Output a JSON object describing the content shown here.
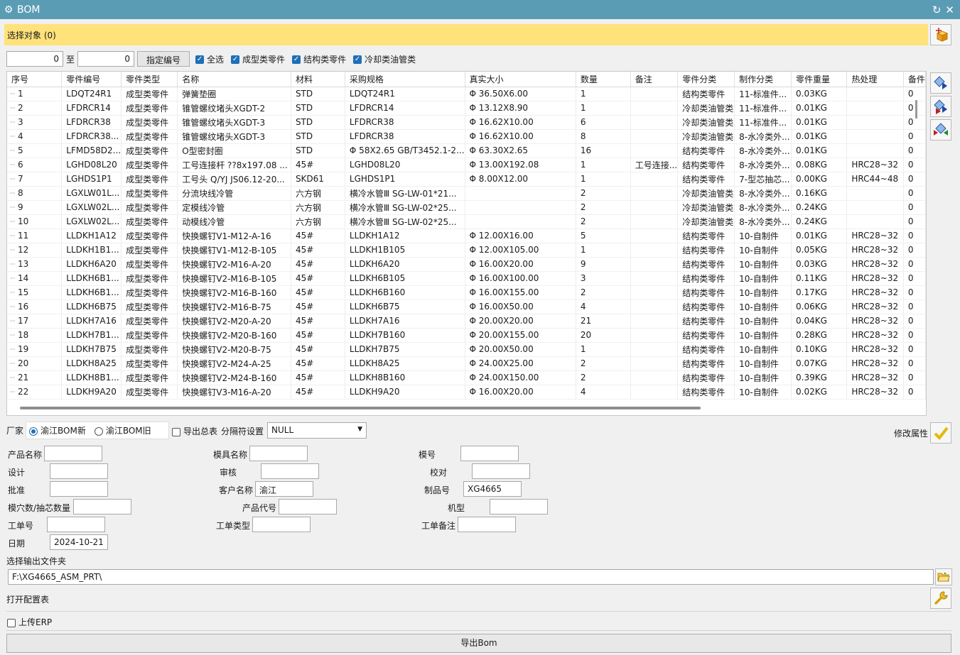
{
  "window": {
    "title": "BOM"
  },
  "select_bar": {
    "label": "选择对象 (0)"
  },
  "range": {
    "from": "0",
    "to_label": "至",
    "to": "0",
    "assign_button": "指定编号"
  },
  "filters": [
    {
      "label": "全选",
      "checked": true
    },
    {
      "label": "成型类零件",
      "checked": true
    },
    {
      "label": "结构类零件",
      "checked": true
    },
    {
      "label": "冷却类油管类",
      "checked": true
    }
  ],
  "table": {
    "columns": [
      "序号",
      "零件编号",
      "零件类型",
      "名称",
      "材料",
      "采购规格",
      "真实大小",
      "数量",
      "备注",
      "零件分类",
      "制作分类",
      "零件重量",
      "热处理",
      "备件"
    ],
    "rows": [
      [
        "1",
        "LDQT24R1",
        "成型类零件",
        "弹簧垫圈",
        "STD",
        "LDQT24R1",
        "Φ 36.50X6.00",
        "1",
        "",
        "结构类零件",
        "11-标准件...",
        "0.03KG",
        "",
        "0"
      ],
      [
        "2",
        "LFDRCR14",
        "成型类零件",
        "锥管螺纹堵头XGDT-2",
        "STD",
        "LFDRCR14",
        "Φ 13.12X8.90",
        "1",
        "",
        "冷却类油管类",
        "11-标准件...",
        "0.01KG",
        "",
        "0"
      ],
      [
        "3",
        "LFDRCR38",
        "成型类零件",
        "锥管螺纹堵头XGDT-3",
        "STD",
        "LFDRCR38",
        "Φ 16.62X10.00",
        "6",
        "",
        "冷却类油管类",
        "11-标准件...",
        "0.01KG",
        "",
        "0"
      ],
      [
        "4",
        "LFDRCR38...",
        "成型类零件",
        "锥管螺纹堵头XGDT-3",
        "STD",
        "LFDRCR38",
        "Φ 16.62X10.00",
        "8",
        "",
        "冷却类油管类",
        "8-水冷类外...",
        "0.01KG",
        "",
        "0"
      ],
      [
        "5",
        "LFMD58D2...",
        "成型类零件",
        "O型密封圈",
        "STD",
        "Φ 58X2.65 GB/T3452.1-2...",
        "Φ 63.30X2.65",
        "16",
        "",
        "结构类零件",
        "8-水冷类外...",
        "0.01KG",
        "",
        "0"
      ],
      [
        "6",
        "LGHD08L20",
        "成型类零件",
        "工号连接杆 ??8x197.08 ...",
        "45#",
        "LGHD08L20",
        "Φ 13.00X192.08",
        "1",
        "工号连接...",
        "结构类零件",
        "8-水冷类外...",
        "0.08KG",
        "HRC28~32",
        "0"
      ],
      [
        "7",
        "LGHDS1P1",
        "成型类零件",
        "工号头 Q/YJ JS06.12-20...",
        "SKD61",
        "LGHDS1P1",
        "Φ 8.00X12.00",
        "1",
        "",
        "结构类零件",
        "7-型芯抽芯...",
        "0.00KG",
        "HRC44~48",
        "0"
      ],
      [
        "8",
        "LGXLW01L...",
        "成型类零件",
        "分流块线冷管",
        "六方钢",
        "横冷水管Ⅲ SG-LW-01*21...",
        "",
        "2",
        "",
        "冷却类油管类",
        "8-水冷类外...",
        "0.16KG",
        "",
        "0"
      ],
      [
        "9",
        "LGXLW02L...",
        "成型类零件",
        "定模线冷管",
        "六方钢",
        "横冷水管Ⅲ SG-LW-02*25...",
        "",
        "2",
        "",
        "冷却类油管类",
        "8-水冷类外...",
        "0.24KG",
        "",
        "0"
      ],
      [
        "10",
        "LGXLW02L...",
        "成型类零件",
        "动模线冷管",
        "六方钢",
        "横冷水管Ⅲ SG-LW-02*25...",
        "",
        "2",
        "",
        "冷却类油管类",
        "8-水冷类外...",
        "0.24KG",
        "",
        "0"
      ],
      [
        "11",
        "LLDKH1A12",
        "成型类零件",
        "快换螺钉V1-M12-A-16",
        "45#",
        "LLDKH1A12",
        "Φ 12.00X16.00",
        "5",
        "",
        "结构类零件",
        "10-自制件",
        "0.01KG",
        "HRC28~32",
        "0"
      ],
      [
        "12",
        "LLDKH1B1...",
        "成型类零件",
        "快换螺钉V1-M12-B-105",
        "45#",
        "LLDKH1B105",
        "Φ 12.00X105.00",
        "1",
        "",
        "结构类零件",
        "10-自制件",
        "0.05KG",
        "HRC28~32",
        "0"
      ],
      [
        "13",
        "LLDKH6A20",
        "成型类零件",
        "快换螺钉V2-M16-A-20",
        "45#",
        "LLDKH6A20",
        "Φ 16.00X20.00",
        "9",
        "",
        "结构类零件",
        "10-自制件",
        "0.03KG",
        "HRC28~32",
        "0"
      ],
      [
        "14",
        "LLDKH6B1...",
        "成型类零件",
        "快换螺钉V2-M16-B-105",
        "45#",
        "LLDKH6B105",
        "Φ 16.00X100.00",
        "3",
        "",
        "结构类零件",
        "10-自制件",
        "0.11KG",
        "HRC28~32",
        "0"
      ],
      [
        "15",
        "LLDKH6B1...",
        "成型类零件",
        "快换螺钉V2-M16-B-160",
        "45#",
        "LLDKH6B160",
        "Φ 16.00X155.00",
        "2",
        "",
        "结构类零件",
        "10-自制件",
        "0.17KG",
        "HRC28~32",
        "0"
      ],
      [
        "16",
        "LLDKH6B75",
        "成型类零件",
        "快换螺钉V2-M16-B-75",
        "45#",
        "LLDKH6B75",
        "Φ 16.00X50.00",
        "4",
        "",
        "结构类零件",
        "10-自制件",
        "0.06KG",
        "HRC28~32",
        "0"
      ],
      [
        "17",
        "LLDKH7A16",
        "成型类零件",
        "快换螺钉V2-M20-A-20",
        "45#",
        "LLDKH7A16",
        "Φ 20.00X20.00",
        "21",
        "",
        "结构类零件",
        "10-自制件",
        "0.04KG",
        "HRC28~32",
        "0"
      ],
      [
        "18",
        "LLDKH7B1...",
        "成型类零件",
        "快换螺钉V2-M20-B-160",
        "45#",
        "LLDKH7B160",
        "Φ 20.00X155.00",
        "20",
        "",
        "结构类零件",
        "10-自制件",
        "0.28KG",
        "HRC28~32",
        "0"
      ],
      [
        "19",
        "LLDKH7B75",
        "成型类零件",
        "快换螺钉V2-M20-B-75",
        "45#",
        "LLDKH7B75",
        "Φ 20.00X50.00",
        "1",
        "",
        "结构类零件",
        "10-自制件",
        "0.10KG",
        "HRC28~32",
        "0"
      ],
      [
        "20",
        "LLDKH8A25",
        "成型类零件",
        "快换螺钉V2-M24-A-25",
        "45#",
        "LLDKH8A25",
        "Φ 24.00X25.00",
        "2",
        "",
        "结构类零件",
        "10-自制件",
        "0.07KG",
        "HRC28~32",
        "0"
      ],
      [
        "21",
        "LLDKH8B1...",
        "成型类零件",
        "快换螺钉V2-M24-B-160",
        "45#",
        "LLDKH8B160",
        "Φ 24.00X150.00",
        "2",
        "",
        "结构类零件",
        "10-自制件",
        "0.39KG",
        "HRC28~32",
        "0"
      ],
      [
        "22",
        "LLDKH9A20",
        "成型类零件",
        "快换螺钉V3-M16-A-20",
        "45#",
        "LLDKH9A20",
        "Φ 16.00X20.00",
        "4",
        "",
        "结构类零件",
        "10-自制件",
        "0.02KG",
        "HRC28~32",
        "0"
      ]
    ]
  },
  "vendor": {
    "label": "厂家",
    "options": [
      {
        "label": "渝江BOM新",
        "selected": true
      },
      {
        "label": "渝江BOM旧",
        "selected": false
      }
    ]
  },
  "export_total": {
    "label": "导出总表",
    "checked": false
  },
  "separator": {
    "label": "分隔符设置",
    "value": "NULL"
  },
  "modify_label": "修改属性",
  "form": {
    "product_name": {
      "label": "产品名称",
      "value": ""
    },
    "mold_name": {
      "label": "模具名称",
      "value": ""
    },
    "mold_no": {
      "label": "模号",
      "value": ""
    },
    "design": {
      "label": "设计",
      "value": ""
    },
    "review": {
      "label": "审核",
      "value": ""
    },
    "proofread": {
      "label": "校对",
      "value": ""
    },
    "approve": {
      "label": "批准",
      "value": ""
    },
    "customer": {
      "label": "客户名称",
      "value": "渝江"
    },
    "product_no": {
      "label": "制品号",
      "value": "XG4665"
    },
    "cavity": {
      "label": "模穴数/抽芯数量",
      "value": ""
    },
    "product_code": {
      "label": "产品代号",
      "value": ""
    },
    "machine": {
      "label": "机型",
      "value": ""
    },
    "work_order": {
      "label": "工单号",
      "value": ""
    },
    "work_type": {
      "label": "工单类型",
      "value": ""
    },
    "work_note": {
      "label": "工单备注",
      "value": ""
    },
    "date": {
      "label": "日期",
      "value": "2024-10-21"
    }
  },
  "output": {
    "label": "选择输出文件夹",
    "path": "F:\\XG4665_ASM_PRT\\"
  },
  "open_config": "打开配置表",
  "upload_erp": {
    "label": "上传ERP",
    "checked": false
  },
  "export_button": "导出Bom",
  "colors": {
    "titlebar": "#5b9cb5",
    "select_bar": "#ffe27a",
    "checkbox": "#1f6fb5"
  }
}
